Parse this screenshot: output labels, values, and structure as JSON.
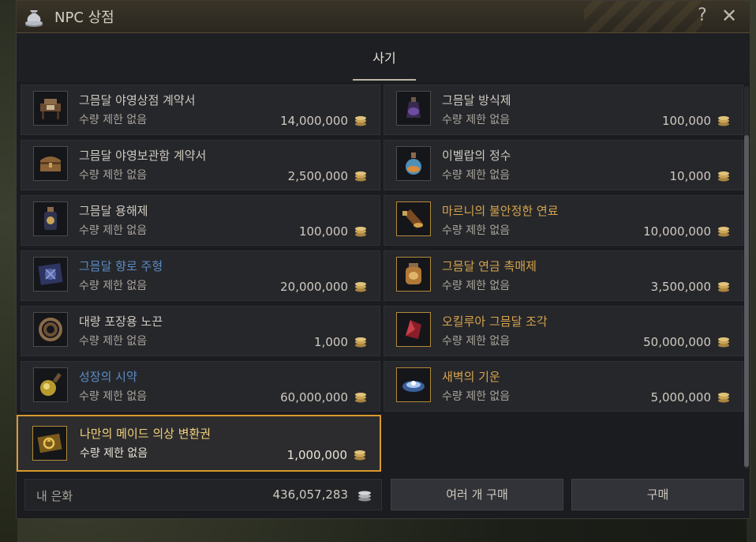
{
  "window": {
    "title": "NPC 상점",
    "help": "?",
    "close": "✕"
  },
  "tabs": [
    {
      "label": "사기",
      "active": true
    }
  ],
  "items": [
    {
      "name": "그믐달 야영상점 계약서",
      "limit": "수량 제한 없음",
      "price": "14,000,000",
      "icon": "camp-shop-table-icon",
      "grade": "normal"
    },
    {
      "name": "그믐달 방식제",
      "limit": "수량 제한 없음",
      "price": "100,000",
      "icon": "potion-bottle-icon",
      "grade": "normal"
    },
    {
      "name": "그믐달 야영보관함 계약서",
      "limit": "수량 제한 없음",
      "price": "2,500,000",
      "icon": "storage-chest-icon",
      "grade": "normal"
    },
    {
      "name": "이벨랍의 정수",
      "limit": "수량 제한 없음",
      "price": "10,000",
      "icon": "essence-flask-icon",
      "grade": "normal"
    },
    {
      "name": "그믐달 용해제",
      "limit": "수량 제한 없음",
      "price": "100,000",
      "icon": "solvent-jar-icon",
      "grade": "normal"
    },
    {
      "name": "마르니의 불안정한 연료",
      "limit": "수량 제한 없음",
      "price": "10,000,000",
      "icon": "fuel-bottle-icon",
      "grade": "gold"
    },
    {
      "name": "그믐달 향로 주형",
      "limit": "수량 제한 없음",
      "price": "20,000,000",
      "icon": "censer-mold-icon",
      "grade": "blue"
    },
    {
      "name": "그믐달 연금 촉매제",
      "limit": "수량 제한 없음",
      "price": "3,500,000",
      "icon": "catalyst-jar-icon",
      "grade": "gold"
    },
    {
      "name": "대량 포장용 노끈",
      "limit": "수량 제한 없음",
      "price": "1,000",
      "icon": "rope-coil-icon",
      "grade": "normal"
    },
    {
      "name": "오킬루아 그믐달 조각",
      "limit": "수량 제한 없음",
      "price": "50,000,000",
      "icon": "red-crystal-icon",
      "grade": "gold"
    },
    {
      "name": "성장의 시약",
      "limit": "수량 제한 없음",
      "price": "60,000,000",
      "icon": "growth-reagent-icon",
      "grade": "blue"
    },
    {
      "name": "새벽의 기운",
      "limit": "수량 제한 없음",
      "price": "5,000,000",
      "icon": "dawn-energy-icon",
      "grade": "gold"
    },
    {
      "name": "나만의 메이드 의상 변환권",
      "limit": "수량 제한 없음",
      "price": "1,000,000",
      "icon": "outfit-voucher-icon",
      "grade": "gold",
      "selected": true
    }
  ],
  "wallet": {
    "label": "내 은화",
    "value": "436,057,283",
    "icon": "silver-coin-stack-icon"
  },
  "buttons": {
    "multi_buy": "여러 개 구매",
    "buy": "구매"
  },
  "colors": {
    "selected_border": "#d99a2b",
    "grade_blue": "#5a8bc4",
    "grade_gold": "#d6a34b"
  }
}
